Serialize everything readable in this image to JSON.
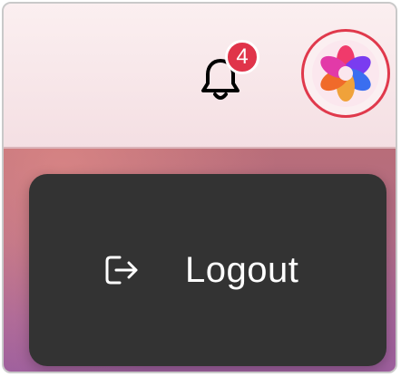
{
  "header": {
    "notifications": {
      "icon": "bell-icon",
      "badge_count": "4",
      "badge_color": "#e0344a"
    },
    "avatar": {
      "icon": "colorful-flower-logo-icon",
      "ring_color": "#e0394c"
    }
  },
  "menu": {
    "items": [
      {
        "label": "Logout",
        "icon": "logout-icon"
      }
    ],
    "background": "#333333"
  }
}
